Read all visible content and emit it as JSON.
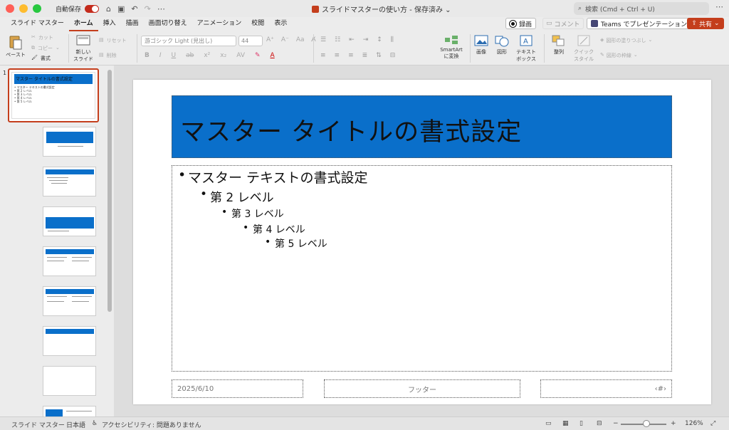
{
  "titlebar": {
    "autosave_label": "自動保存",
    "doc_title": "スライドマスターの使い方 - 保存済み ⌄",
    "search_placeholder": "検索 (Cmd + Ctrl + U)",
    "more": "⋯"
  },
  "tabs": [
    {
      "label": "スライド マスター"
    },
    {
      "label": "ホーム"
    },
    {
      "label": "挿入"
    },
    {
      "label": "描画"
    },
    {
      "label": "画面切り替え"
    },
    {
      "label": "アニメーション"
    },
    {
      "label": "校閲"
    },
    {
      "label": "表示"
    }
  ],
  "topright": {
    "record": "録画",
    "comment": "コメント",
    "teams": "Teams でプレゼンテーション",
    "share": "共有"
  },
  "ribbon": {
    "paste": "ペースト",
    "cut": "カット",
    "copy": "コピー",
    "format": "書式",
    "new_slide_1": "新しい",
    "new_slide_2": "スライド",
    "reset": "リセット",
    "delete": "削除",
    "font": "游ゴシック Light (見出し)",
    "size": "44",
    "smartart_1": "SmartArt",
    "smartart_2": "に変換",
    "image": "画像",
    "shape": "図形",
    "textbox_1": "テキスト",
    "textbox_2": "ボックス",
    "arrange": "整列",
    "quickstyle_1": "クイック",
    "quickstyle_2": "スタイル",
    "shape_fill": "図形の塗りつぶし",
    "shape_outline": "図形の枠線"
  },
  "panel": {
    "slide_number": "1",
    "master_title": "マスター タイトルの書式設定",
    "master_body": [
      "• マスター テキストの書式設定",
      "  • 第 2 レベル",
      "    • 第 3 レベル",
      "      • 第 4 レベル",
      "        • 第 5 レベル"
    ]
  },
  "slide": {
    "title": "マスター タイトルの書式設定",
    "levels": [
      "マスター テキストの書式設定",
      "第 2 レベル",
      "第 3 レベル",
      "第 4 レベル",
      "第 5 レベル"
    ],
    "date": "2025/6/10",
    "footer": "フッター",
    "page_number": "‹#›"
  },
  "status": {
    "view": "スライド マスター",
    "language": "日本語",
    "accessibility": "アクセシビリティ: 問題ありません",
    "zoom": "126%"
  },
  "colors": {
    "accent": "#c43e1c",
    "title_fill": "#0a6fca"
  }
}
